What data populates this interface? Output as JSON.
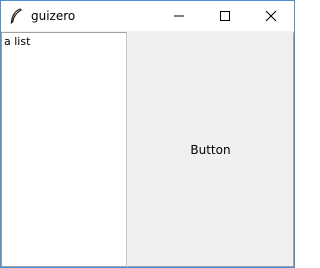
{
  "window": {
    "title": "guizero",
    "icon": "feather-icon",
    "controls": {
      "minimize_icon": "minimize-icon",
      "maximize_icon": "maximize-icon",
      "close_icon": "close-icon"
    },
    "border_color": "#4a90d9"
  },
  "listbox": {
    "items": [
      {
        "label": "a list"
      }
    ]
  },
  "button": {
    "label": "Button"
  }
}
